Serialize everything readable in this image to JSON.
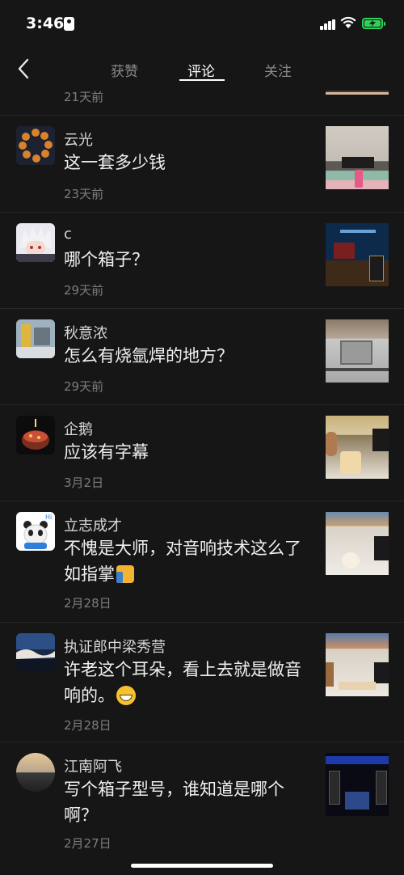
{
  "status_bar": {
    "time": "3:46"
  },
  "nav": {
    "tabs": [
      {
        "label": "获赞"
      },
      {
        "label": "评论"
      },
      {
        "label": "关注"
      }
    ],
    "active_tab": "评论"
  },
  "comments": [
    {
      "name": "",
      "text": "",
      "date": "21天前"
    },
    {
      "name": "云光",
      "text": "这一套多少钱",
      "date": "23天前"
    },
    {
      "name": "c",
      "text": "哪个箱子？",
      "date": "29天前"
    },
    {
      "name": "秋意浓",
      "text": "怎么有烧氩焊的地方？",
      "date": "29天前"
    },
    {
      "name": "企鹅",
      "text": "应该有字幕",
      "date": "3月2日"
    },
    {
      "name": "立志成才",
      "text": "不愧是大师，对音响技术这么了如指掌",
      "date": "2月28日"
    },
    {
      "name": "执证郎中梁秀营",
      "text": "许老这个耳朵，看上去就是做音响的。",
      "date": "2月28日"
    },
    {
      "name": "江南阿飞",
      "text": "写个箱子型号，谁知道是哪个啊？",
      "date": "2月27日"
    }
  ],
  "icons": {
    "back": "chevron-left-icon",
    "emoji_1": "thumbs-up-emoji-icon",
    "emoji_2": "grinning-face-emoji-icon"
  },
  "colors": {
    "background": "#161616",
    "battery": "#30d158"
  }
}
